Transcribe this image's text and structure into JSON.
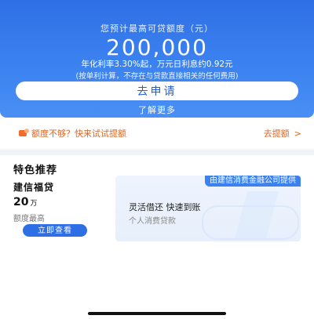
{
  "hero": {
    "label": "您预计最高可贷额度（元）",
    "amount": "200,000",
    "rate": "年化利率3.30%起，万元日利息约0.92元",
    "note": "(按单利计算，不存在与贷款直接相关的任何费用)",
    "apply_label": "去申请",
    "learn_more": "了解更多"
  },
  "promo": {
    "text": "额度不够？快来试试提额",
    "link": "去提额",
    "chevron": ">",
    "accent": "#e0641f"
  },
  "featured": {
    "title": "特色推荐",
    "provider": "由建信消费金融公司提供",
    "product": "建信福贷",
    "amount": "20",
    "unit": "万",
    "amount_label": "额度最高",
    "feature": "灵活借还 快速到账",
    "sub_feature": "个人消费贷款",
    "cta": "立即查看"
  },
  "colors": {
    "primary": "#2f6fe6",
    "accent": "#e0641f"
  }
}
